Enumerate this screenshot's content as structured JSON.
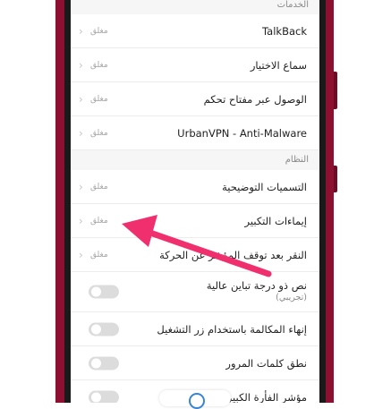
{
  "sections": {
    "services_header": "الخدمات",
    "system_header": "النظام"
  },
  "services": [
    {
      "label": "TalkBack",
      "value": "مغلق"
    },
    {
      "label": "سماع الاختيار",
      "value": "مغلق"
    },
    {
      "label": "الوصول عبر مفتاح تحكم",
      "value": "مغلق"
    },
    {
      "label": "UrbanVPN - Anti-Malware",
      "value": "مغلق"
    }
  ],
  "system": [
    {
      "label": "التسميات التوضيحية",
      "value": "مغلق"
    },
    {
      "label": "إيماءات التكبير",
      "value": "مغلق"
    },
    {
      "label": "النقر بعد توقف المؤشر عن الحركة",
      "value": "مغلق"
    }
  ],
  "toggles": [
    {
      "label": "نص ذو درجة تباين عالية",
      "sub": "(تجريبي)",
      "on": false
    },
    {
      "label": "إنهاء المكالمة باستخدام زر التشغيل",
      "on": false
    },
    {
      "label": "نطق كلمات المرور",
      "on": false
    },
    {
      "label": "مؤشر الفأرة الكبير",
      "on": false
    }
  ],
  "colors": {
    "frame": "#8e1030",
    "arrow": "#f0306e",
    "accent": "#3a84d6"
  },
  "icons": {
    "chevron": "chevron-left-icon"
  }
}
